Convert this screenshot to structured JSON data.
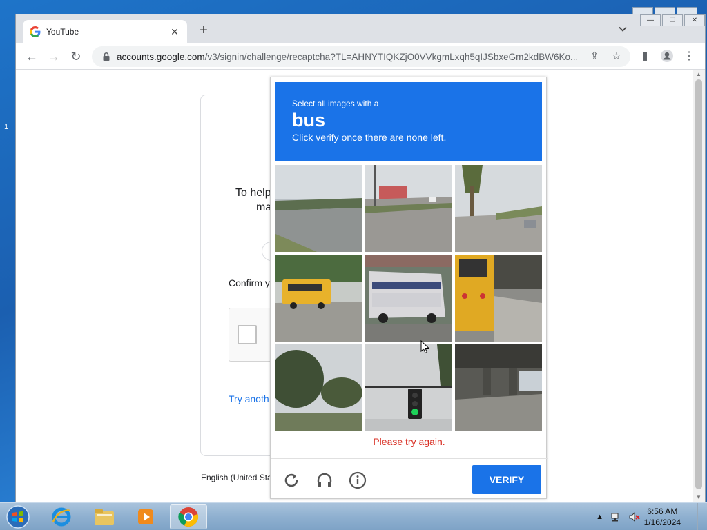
{
  "browser": {
    "tab_title": "YouTube",
    "new_tab": "+",
    "url_host": "accounts.google.com",
    "url_path": "/v3/signin/challenge/recaptcha?TL=AHNYTIQKZjO0VVkgmLxqh5qIJSbxeGm2kdBW6Ko..."
  },
  "page": {
    "help_text": "To help",
    "help_text2": "ma",
    "confirm_text": "Confirm y",
    "try_another": "Try anoth",
    "language": "English (United Sta"
  },
  "recaptcha": {
    "instruction_line1": "Select all images with a",
    "target": "bus",
    "instruction_line3": "Click verify once there are none left.",
    "error": "Please try again.",
    "verify_label": "VERIFY",
    "tiles": [
      "road-scene",
      "street-scene",
      "palm-street-scene",
      "school-bus",
      "city-bus",
      "school-bus-rear",
      "trees",
      "traffic-light",
      "overpass"
    ]
  },
  "taskbar": {
    "time": "6:56 AM",
    "date": "1/16/2024"
  },
  "colors": {
    "accent": "#1a73e8",
    "error": "#d93025"
  }
}
